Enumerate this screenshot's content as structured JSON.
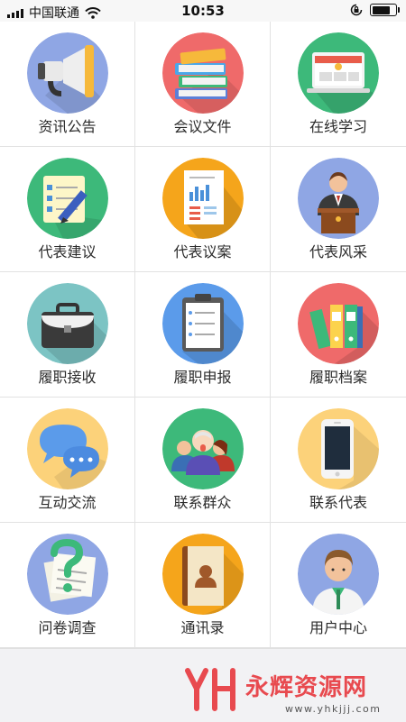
{
  "status_bar": {
    "carrier": "中国联通",
    "time": "10:53",
    "battery_level": 0.9
  },
  "menu": [
    {
      "label": "资讯公告",
      "icon": "megaphone-icon",
      "color": "#8fa6e4"
    },
    {
      "label": "会议文件",
      "icon": "books-icon",
      "color": "#ef6a6a"
    },
    {
      "label": "在线学习",
      "icon": "laptop-icon",
      "color": "#3db97a"
    },
    {
      "label": "代表建议",
      "icon": "notepad-pencil-icon",
      "color": "#3db97a"
    },
    {
      "label": "代表议案",
      "icon": "document-chart-icon",
      "color": "#f5a51b"
    },
    {
      "label": "代表风采",
      "icon": "speaker-podium-icon",
      "color": "#8fa6e4"
    },
    {
      "label": "履职接收",
      "icon": "briefcase-icon",
      "color": "#7cc4c4"
    },
    {
      "label": "履职申报",
      "icon": "clipboard-icon",
      "color": "#5b9bea"
    },
    {
      "label": "履职档案",
      "icon": "binders-icon",
      "color": "#ef6a6a"
    },
    {
      "label": "互动交流",
      "icon": "chat-bubbles-icon",
      "color": "#fcd27a"
    },
    {
      "label": "联系群众",
      "icon": "people-group-icon",
      "color": "#3db97a"
    },
    {
      "label": "联系代表",
      "icon": "smartphone-icon",
      "color": "#fcd27a"
    },
    {
      "label": "问卷调查",
      "icon": "questionnaire-icon",
      "color": "#8fa6e4"
    },
    {
      "label": "通讯录",
      "icon": "address-book-icon",
      "color": "#f5a51b"
    },
    {
      "label": "用户中心",
      "icon": "user-avatar-icon",
      "color": "#8fa6e4"
    }
  ],
  "footer": {
    "brand": "永辉资源网",
    "url": "www.yhkjjj.com",
    "brand_color": "#e84a4f"
  }
}
